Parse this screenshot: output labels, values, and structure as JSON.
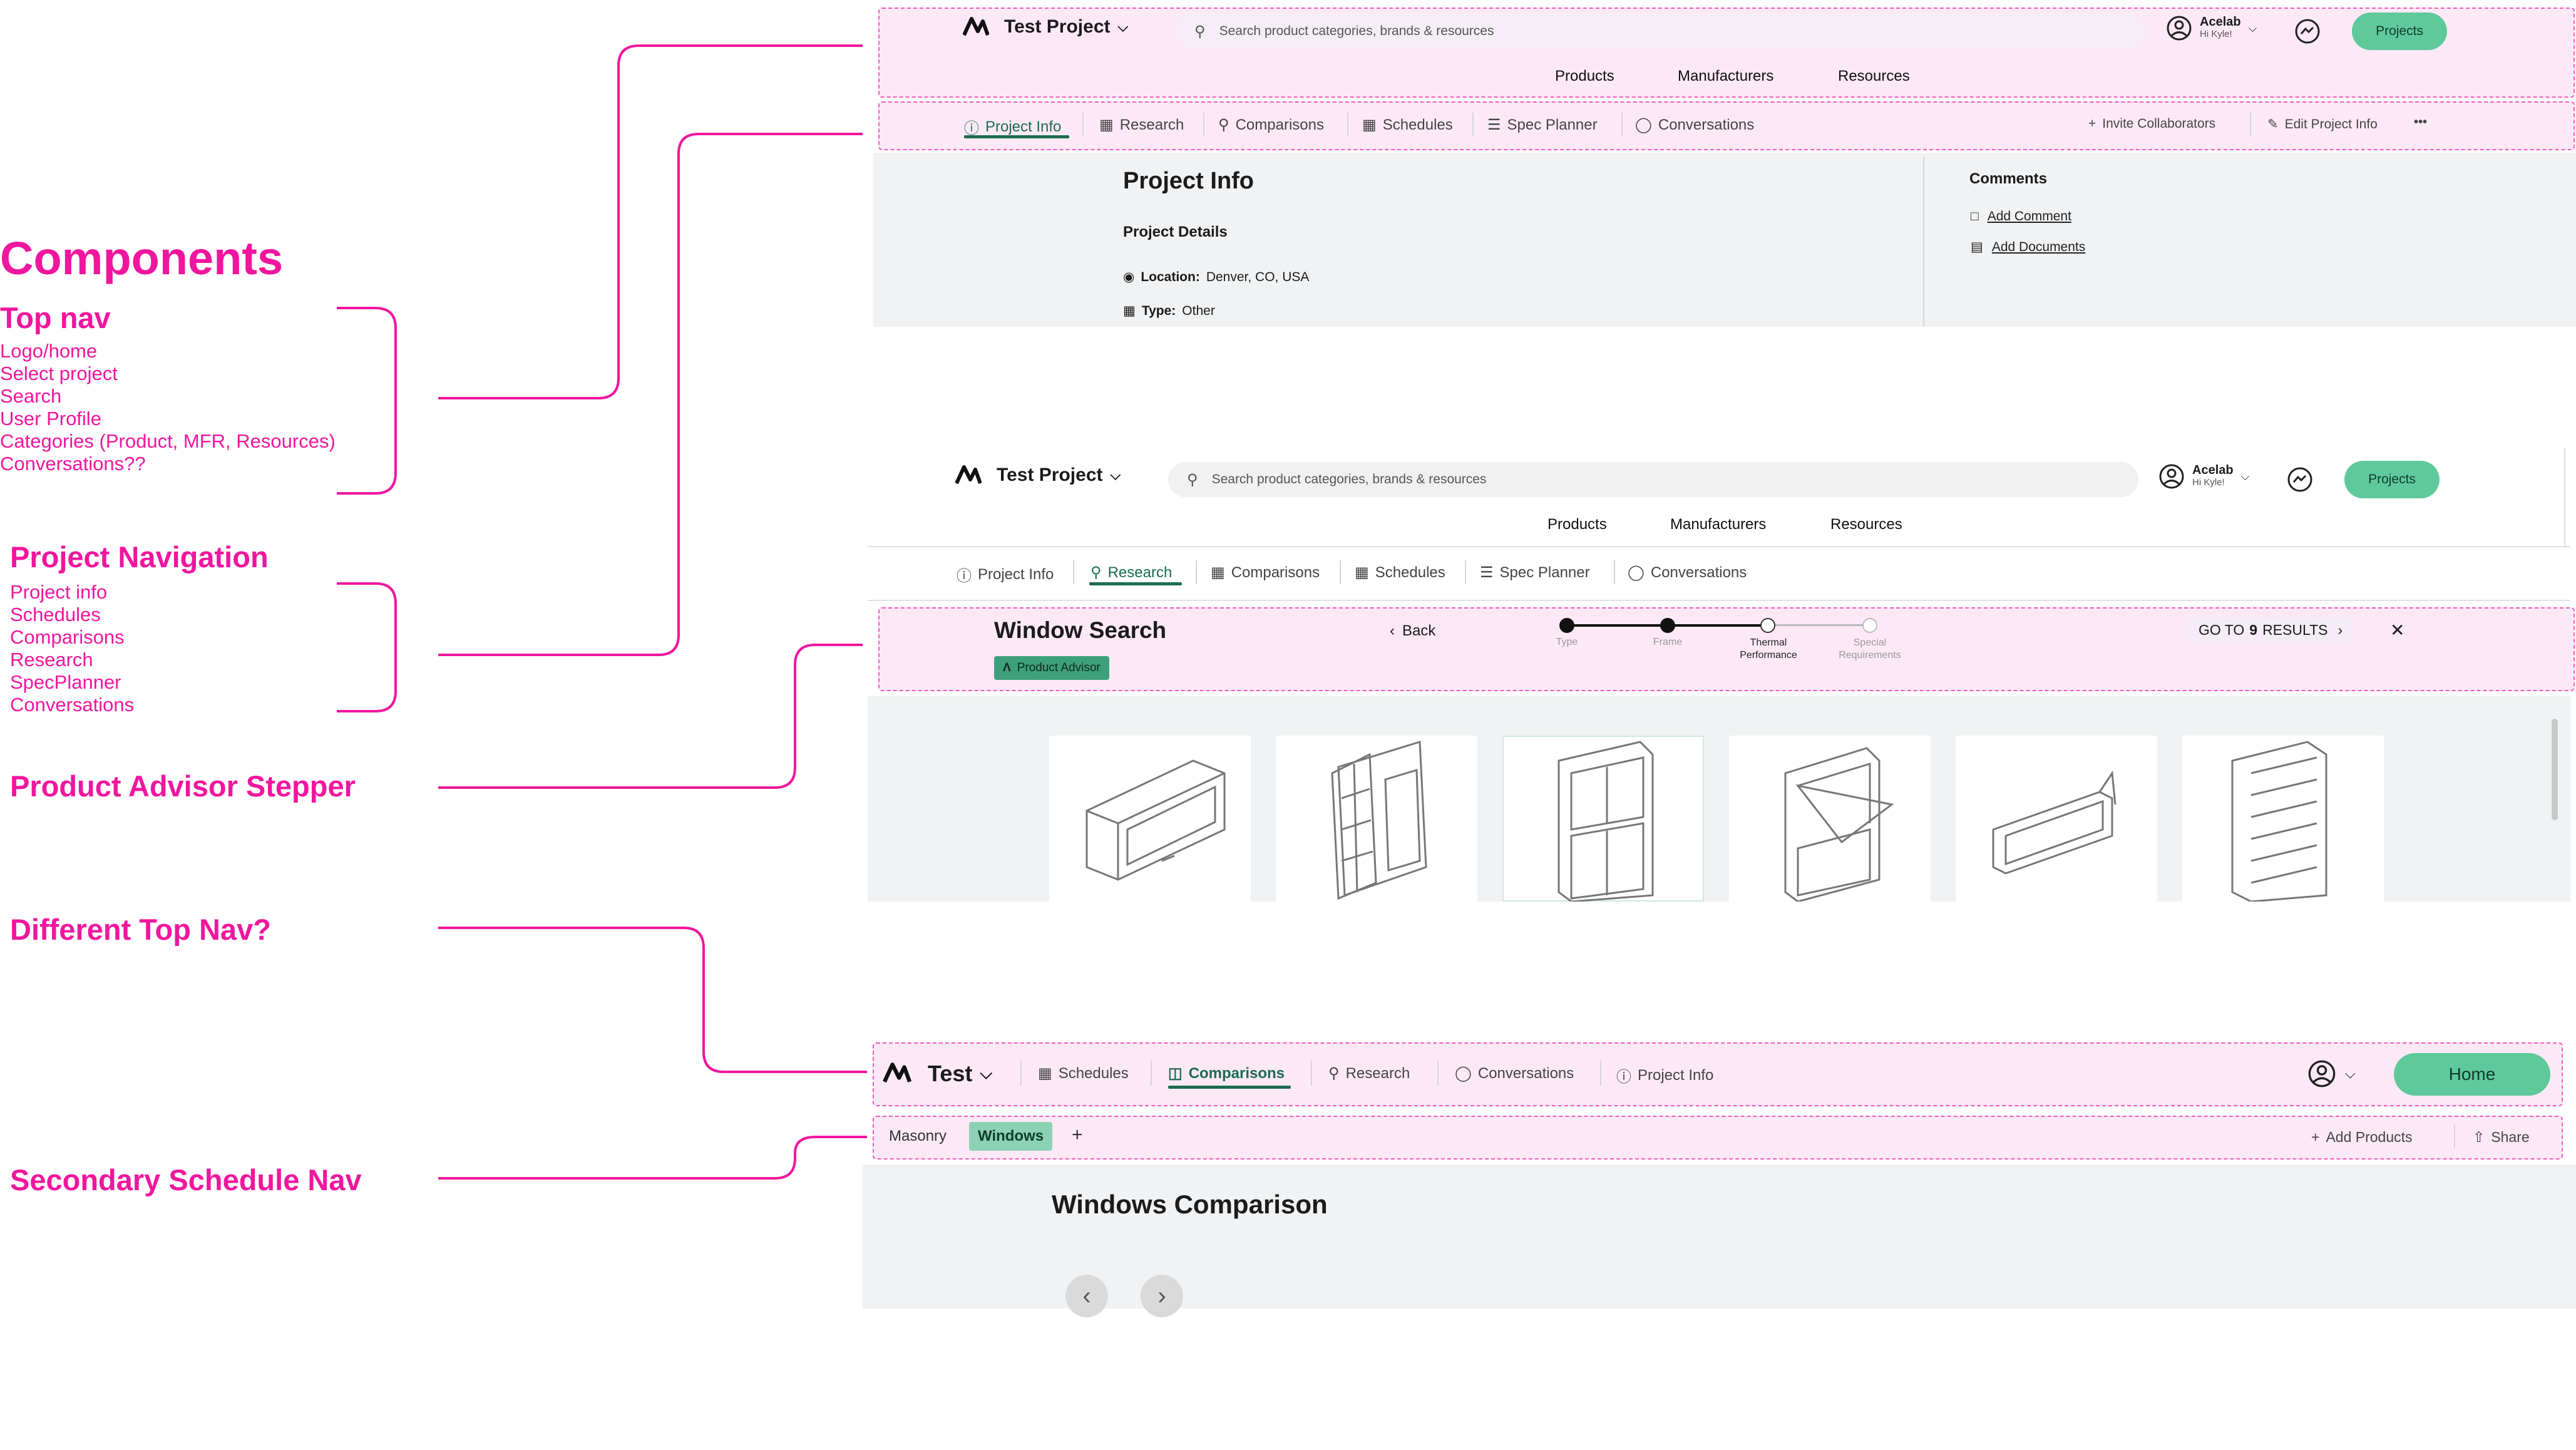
{
  "annotations": {
    "components_title": "Components",
    "top_nav": {
      "title": "Top nav",
      "items": [
        "Logo/home",
        "Select project",
        "Search",
        "User Profile",
        "Categories (Product, MFR, Resources)",
        "Conversations??"
      ]
    },
    "project_nav": {
      "title": "Project Navigation",
      "items": [
        "Project info",
        "Schedules",
        "Comparisons",
        "Research",
        "SpecPlanner",
        "Conversations"
      ]
    },
    "stepper_title": "Product Advisor Stepper",
    "diff_nav_title": "Different Top Nav?",
    "secondary_nav_title": "Secondary Schedule Nav"
  },
  "screen1": {
    "project_name": "Test Project",
    "search_placeholder": "Search product categories, brands & resources",
    "user_name": "Acelab",
    "user_greeting": "Hi Kyle!",
    "projects_button": "Projects",
    "categories": [
      "Products",
      "Manufacturers",
      "Resources"
    ],
    "tabs": [
      "Project Info",
      "Research",
      "Comparisons",
      "Schedules",
      "Spec Planner",
      "Conversations"
    ],
    "active_tab": "Project Info",
    "invite": "Invite Collaborators",
    "edit": "Edit Project Info",
    "more": "•••",
    "page_title": "Project Info",
    "details_heading": "Project Details",
    "location_label": "Location:",
    "location_value": "Denver, CO, USA",
    "type_label": "Type:",
    "type_value": "Other",
    "comments_heading": "Comments",
    "add_comment": "Add Comment",
    "add_documents": "Add Documents"
  },
  "screen2": {
    "project_name": "Test Project",
    "search_placeholder": "Search product categories, brands & resources",
    "user_name": "Acelab",
    "user_greeting": "Hi Kyle!",
    "projects_button": "Projects",
    "categories": [
      "Products",
      "Manufacturers",
      "Resources"
    ],
    "tabs": [
      "Project Info",
      "Research",
      "Comparisons",
      "Schedules",
      "Spec Planner",
      "Conversations"
    ],
    "active_tab": "Research",
    "stepper": {
      "title": "Window Search",
      "badge": "Product Advisor",
      "back": "Back",
      "steps": [
        {
          "label": "Type",
          "state": "done"
        },
        {
          "label": "Frame",
          "state": "done"
        },
        {
          "label": "Thermal Performance",
          "state": "current"
        },
        {
          "label": "Special Requirements",
          "state": "todo"
        }
      ],
      "results_prefix": "GO TO",
      "results_count": "9",
      "results_suffix": "RESULTS"
    }
  },
  "screen3": {
    "project_name": "Test",
    "tabs": [
      "Schedules",
      "Comparisons",
      "Research",
      "Conversations",
      "Project Info"
    ],
    "active_tab": "Comparisons",
    "home_button": "Home",
    "sub_tabs": [
      "Masonry",
      "Windows"
    ],
    "active_sub_tab": "Windows",
    "add_products": "Add Products",
    "share": "Share",
    "page_title": "Windows Comparison"
  },
  "colors": {
    "accent": "#f0169e",
    "brand_green": "#5fc99c",
    "active_tab": "#1c6c4f"
  }
}
